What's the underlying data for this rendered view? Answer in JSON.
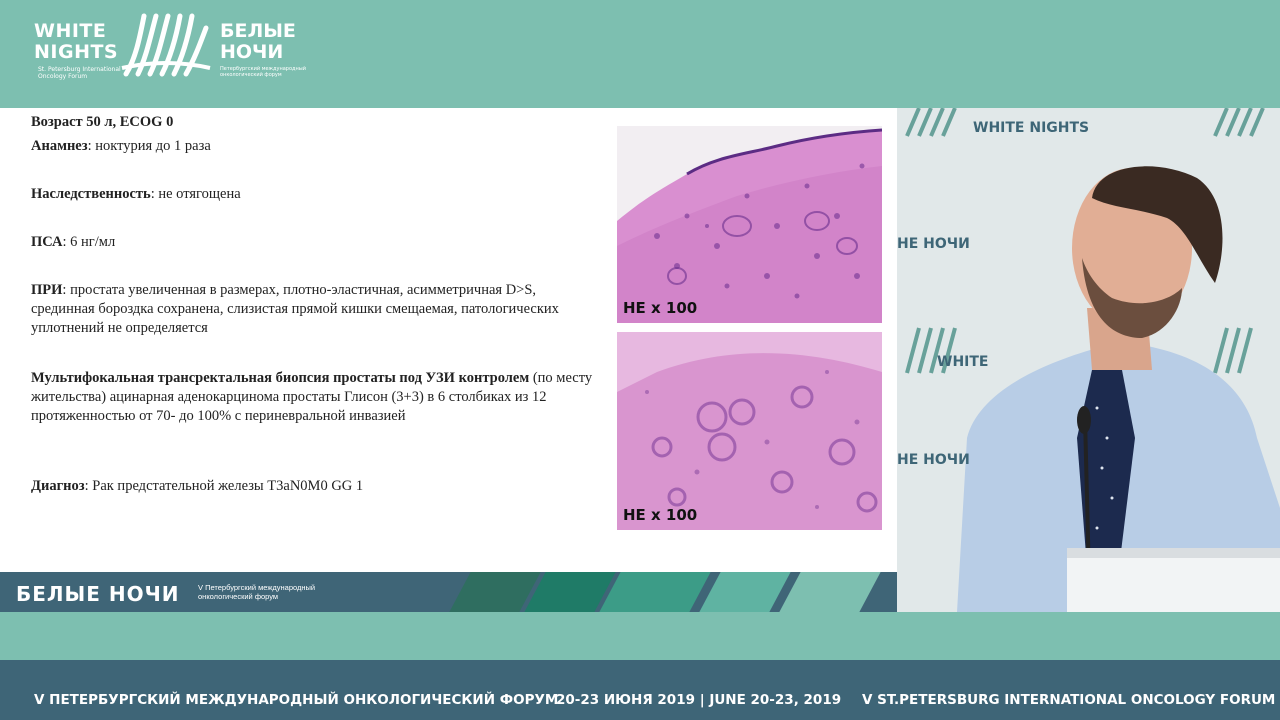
{
  "header": {
    "logo_en_line1": "WHITE",
    "logo_en_line2": "NIGHTS",
    "logo_en_sub": "St. Petersburg International Oncology Forum",
    "logo_ru_line1": "БЕЛЫЕ",
    "logo_ru_line2": "НОЧИ",
    "logo_ru_sub": "Петербургский международный онкологический форум"
  },
  "slide": {
    "age_label": "Возраст 50 л, ECOG 0",
    "anamnesis_label": "Анамнез",
    "anamnesis_text": ": ноктурия до 1 раза",
    "heredity_label": "Наследственность",
    "heredity_text": ": не отягощена",
    "psa_label": "ПСА",
    "psa_text": ": 6 нг/мл",
    "dre_label": "ПРИ",
    "dre_text": ": простата увеличенная в размерах, плотно-эластичная, асимметричная D>S, срединная бороздка сохранена, слизистая прямой кишки смещаемая, патологических уплотнений не определяется",
    "biopsy_label": "Мультифокальная трансректальная биопсия простаты под УЗИ контролем",
    "biopsy_text": " (по месту жительства) ацинарная аденокарцинома простаты Глисон (3+3) в 6 столбиках из 12 протяженностью от 70- до 100% с периневральной инвазией",
    "diagnosis_label": "Диагноз",
    "diagnosis_text": ": Рак предстательной железы T3aN0M0 GG 1",
    "histo_label_1": "HE x 100",
    "histo_label_2": "HE x 100"
  },
  "band": {
    "title": "БЕЛЫЕ НОЧИ",
    "subtitle": "V Петербургский международный онкологический форум"
  },
  "video": {
    "wall_text_1": "WHITE NIGHTS",
    "wall_text_2": "НЕ НОЧИ",
    "wall_text_3": "WHITE",
    "wall_text_4": "НЕ НОЧИ"
  },
  "ticker": {
    "left": "V ПЕТЕРБУРГСКИЙ МЕЖДУНАРОДНЫЙ ОНКОЛОГИЧЕСКИЙ ФОРУМ",
    "center": "20-23 ИЮНЯ 2019 | JUNE 20-23, 2019",
    "right": "V ST.PETERSBURG INTERNATIONAL ONCOLOGY FORUM"
  },
  "colors": {
    "brand_teal": "#7dbfb0",
    "brand_dark": "#3e6577",
    "histo_pink": "#d78fcd",
    "histo_purple": "#6a2e8e"
  }
}
